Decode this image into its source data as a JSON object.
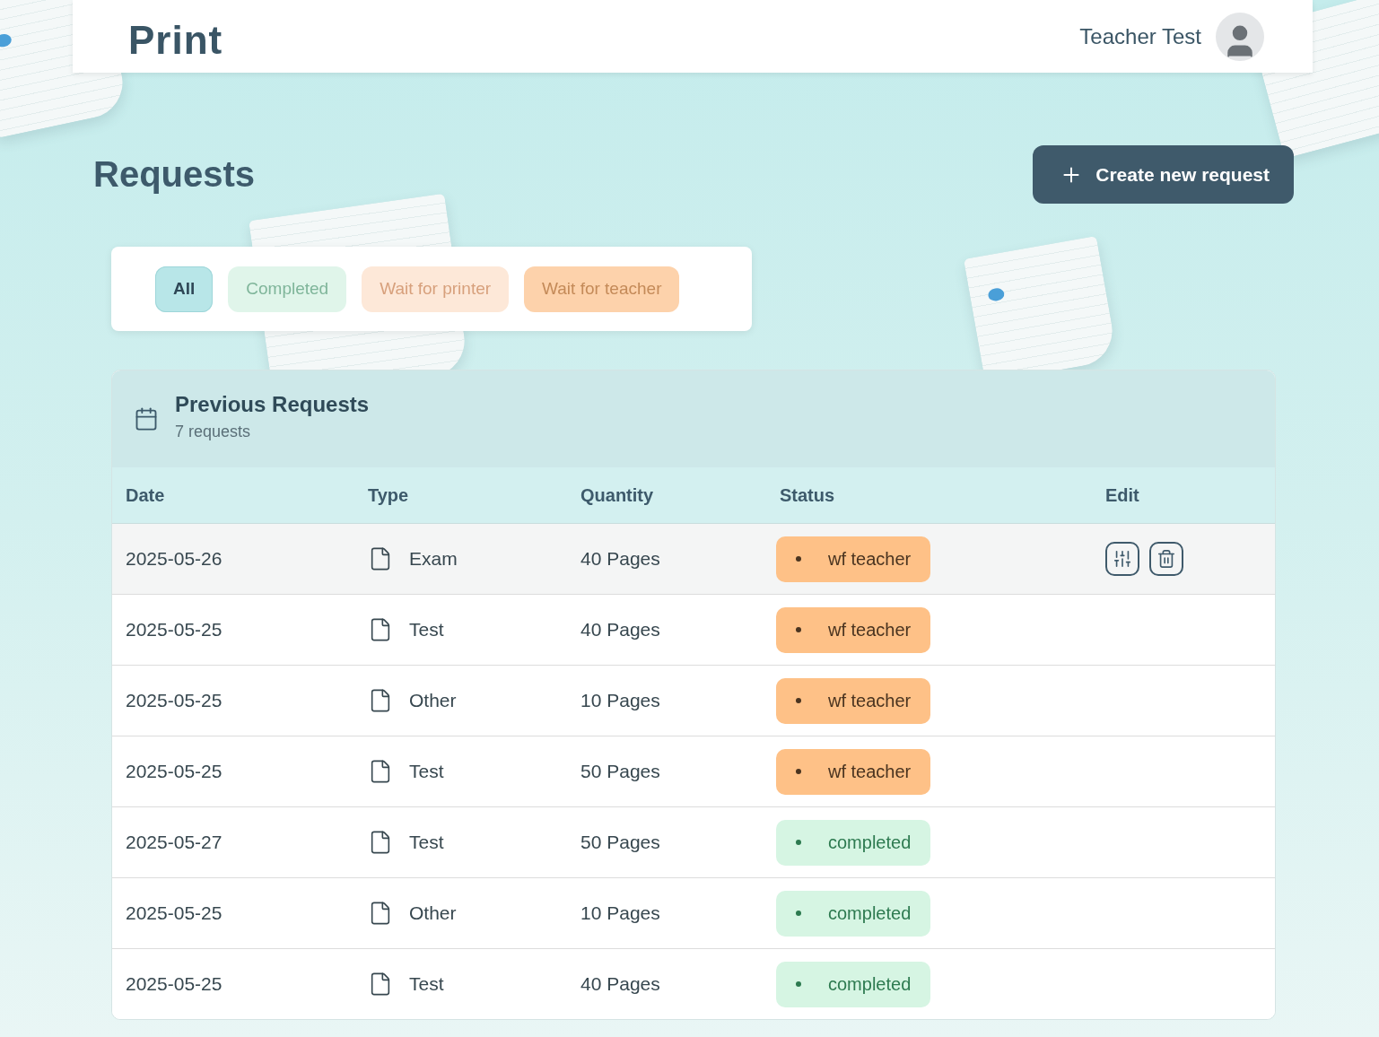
{
  "header": {
    "logo": "Print",
    "user_name": "Teacher Test"
  },
  "page_title": "Requests",
  "create_button": "Create new request",
  "filters": [
    {
      "label": "All",
      "kind": "all",
      "selected": true
    },
    {
      "label": "Completed",
      "kind": "completed",
      "selected": false
    },
    {
      "label": "Wait for printer",
      "kind": "printer",
      "selected": false
    },
    {
      "label": "Wait for teacher",
      "kind": "teacher",
      "selected": false
    }
  ],
  "table": {
    "title": "Previous Requests",
    "subtitle": "7 requests",
    "columns": [
      "Date",
      "Type",
      "Quantity",
      "Status",
      "Edit"
    ],
    "rows": [
      {
        "date": "2025-05-26",
        "type": "Exam",
        "quantity": "40 Pages",
        "status": {
          "label": "wf teacher",
          "kind": "teacher"
        },
        "hovered": true
      },
      {
        "date": "2025-05-25",
        "type": "Test",
        "quantity": "40 Pages",
        "status": {
          "label": "wf teacher",
          "kind": "teacher"
        },
        "hovered": false
      },
      {
        "date": "2025-05-25",
        "type": "Other",
        "quantity": "10 Pages",
        "status": {
          "label": "wf teacher",
          "kind": "teacher"
        },
        "hovered": false
      },
      {
        "date": "2025-05-25",
        "type": "Test",
        "quantity": "50 Pages",
        "status": {
          "label": "wf teacher",
          "kind": "teacher"
        },
        "hovered": false
      },
      {
        "date": "2025-05-27",
        "type": "Test",
        "quantity": "50 Pages",
        "status": {
          "label": "completed",
          "kind": "completed"
        },
        "hovered": false
      },
      {
        "date": "2025-05-25",
        "type": "Other",
        "quantity": "10 Pages",
        "status": {
          "label": "completed",
          "kind": "completed"
        },
        "hovered": false
      },
      {
        "date": "2025-05-25",
        "type": "Test",
        "quantity": "40 Pages",
        "status": {
          "label": "completed",
          "kind": "completed"
        },
        "hovered": false
      }
    ]
  }
}
